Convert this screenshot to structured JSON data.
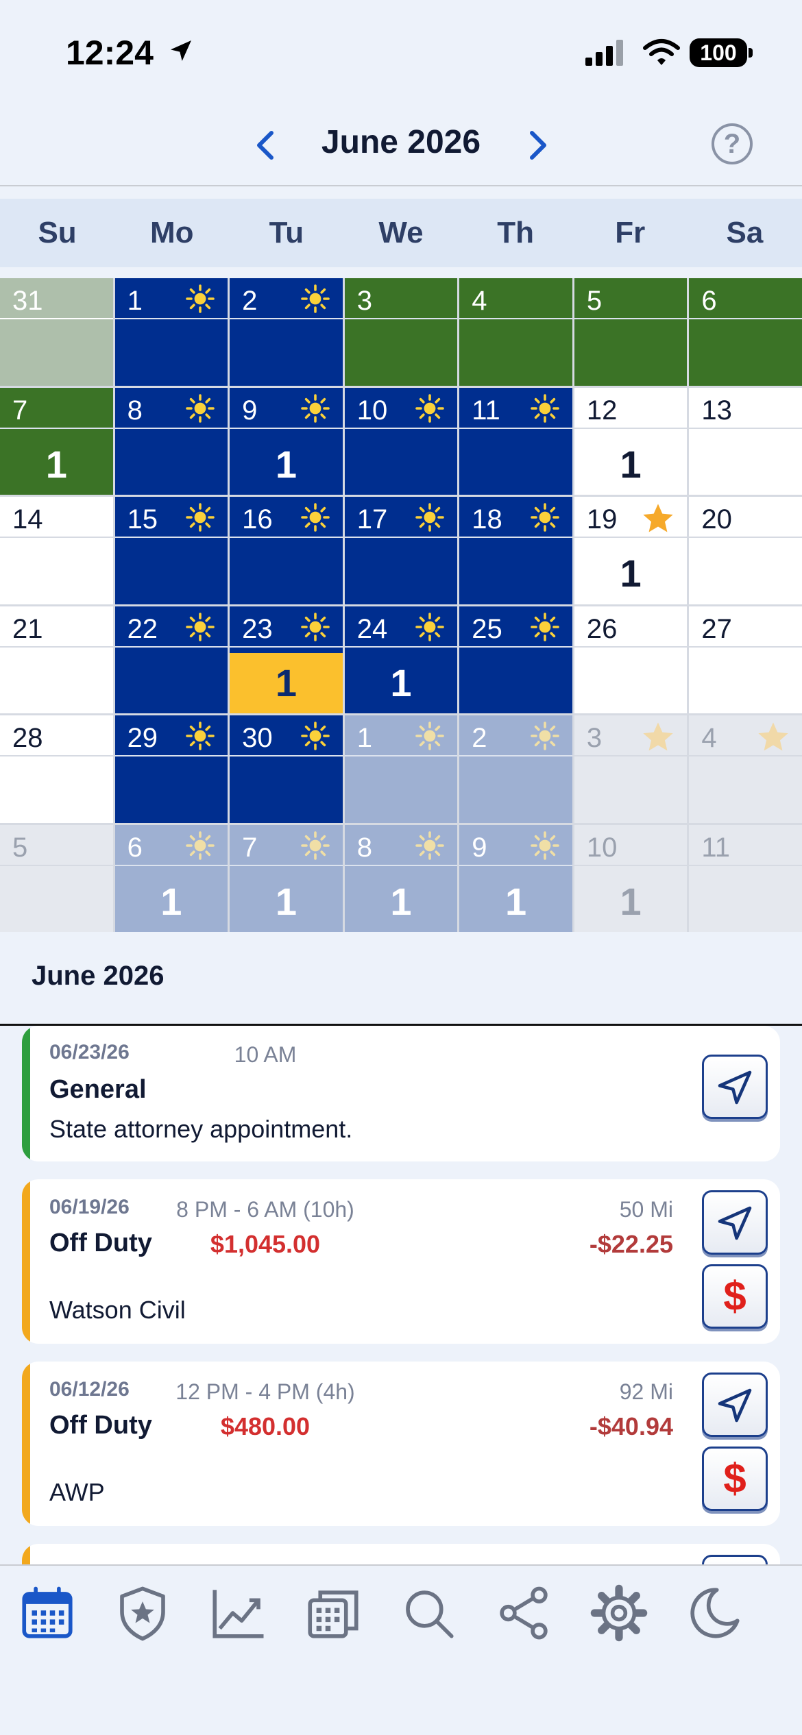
{
  "status_bar": {
    "time": "12:24",
    "battery": "100"
  },
  "header": {
    "title": "June 2026"
  },
  "calendar": {
    "weekdays": [
      "Su",
      "Mo",
      "Tu",
      "We",
      "Th",
      "Fr",
      "Sa"
    ],
    "weeks": [
      [
        {
          "day": "31",
          "type": "grey"
        },
        {
          "day": "1",
          "type": "blue",
          "icon": "sun"
        },
        {
          "day": "2",
          "type": "blue",
          "icon": "sun"
        },
        {
          "day": "3",
          "type": "green"
        },
        {
          "day": "4",
          "type": "green"
        },
        {
          "day": "5",
          "type": "green"
        },
        {
          "day": "6",
          "type": "green"
        }
      ],
      [
        {
          "day": "7",
          "type": "green",
          "count": "1"
        },
        {
          "day": "8",
          "type": "blue",
          "icon": "sun"
        },
        {
          "day": "9",
          "type": "blue",
          "icon": "sun",
          "count": "1"
        },
        {
          "day": "10",
          "type": "blue",
          "icon": "sun"
        },
        {
          "day": "11",
          "type": "blue",
          "icon": "sun"
        },
        {
          "day": "12",
          "type": "white",
          "count": "1"
        },
        {
          "day": "13",
          "type": "white"
        }
      ],
      [
        {
          "day": "14",
          "type": "white"
        },
        {
          "day": "15",
          "type": "blue",
          "icon": "sun"
        },
        {
          "day": "16",
          "type": "blue",
          "icon": "sun"
        },
        {
          "day": "17",
          "type": "blue",
          "icon": "sun"
        },
        {
          "day": "18",
          "type": "blue",
          "icon": "sun"
        },
        {
          "day": "19",
          "type": "white",
          "icon": "star",
          "count": "1"
        },
        {
          "day": "20",
          "type": "white"
        }
      ],
      [
        {
          "day": "21",
          "type": "white"
        },
        {
          "day": "22",
          "type": "blue",
          "icon": "sun"
        },
        {
          "day": "23",
          "type": "blue",
          "icon": "sun",
          "count": "1",
          "highlight": true
        },
        {
          "day": "24",
          "type": "blue",
          "icon": "sun",
          "count": "1"
        },
        {
          "day": "25",
          "type": "blue",
          "icon": "sun"
        },
        {
          "day": "26",
          "type": "white"
        },
        {
          "day": "27",
          "type": "white"
        }
      ],
      [
        {
          "day": "28",
          "type": "white"
        },
        {
          "day": "29",
          "type": "blue",
          "icon": "sun"
        },
        {
          "day": "30",
          "type": "blue",
          "icon": "sun"
        },
        {
          "day": "1",
          "type": "fblue",
          "icon": "sun"
        },
        {
          "day": "2",
          "type": "fblue",
          "icon": "sun"
        },
        {
          "day": "3",
          "type": "fwhite",
          "icon": "star"
        },
        {
          "day": "4",
          "type": "fwhite",
          "icon": "star"
        }
      ],
      [
        {
          "day": "5",
          "type": "fwhite"
        },
        {
          "day": "6",
          "type": "fblue",
          "icon": "sun",
          "count": "1"
        },
        {
          "day": "7",
          "type": "fblue",
          "icon": "sun",
          "count": "1"
        },
        {
          "day": "8",
          "type": "fblue",
          "icon": "sun",
          "count": "1"
        },
        {
          "day": "9",
          "type": "fblue",
          "icon": "sun",
          "count": "1"
        },
        {
          "day": "10",
          "type": "fwhite",
          "count": "1"
        },
        {
          "day": "11",
          "type": "fwhite"
        }
      ]
    ]
  },
  "section": {
    "title": "June 2026"
  },
  "events": [
    {
      "date": "06/23/26",
      "time": "10 AM",
      "type": "General",
      "description": "State attorney appointment.",
      "accent": "#2e9e3e"
    },
    {
      "date": "06/19/26",
      "time": "8 PM - 6 AM (10h)",
      "type": "Off Duty",
      "pay": "$1,045.00",
      "miles": "50 Mi",
      "cost": "-$22.25",
      "description": "Watson Civil",
      "accent": "#f2a81d",
      "dollar": "$"
    },
    {
      "date": "06/12/26",
      "time": "12 PM - 4 PM (4h)",
      "type": "Off Duty",
      "pay": "$480.00",
      "miles": "92 Mi",
      "cost": "-$40.94",
      "description": "AWP",
      "accent": "#f2a81d",
      "dollar": "$"
    }
  ],
  "tabbar": {
    "icons": [
      "calendar-icon",
      "shield-star-icon",
      "chart-icon",
      "calendar-stack-icon",
      "search-icon",
      "share-icon",
      "gear-icon",
      "moon-icon"
    ],
    "active_color": "#1a57c8",
    "inactive_color": "#6b7384"
  }
}
